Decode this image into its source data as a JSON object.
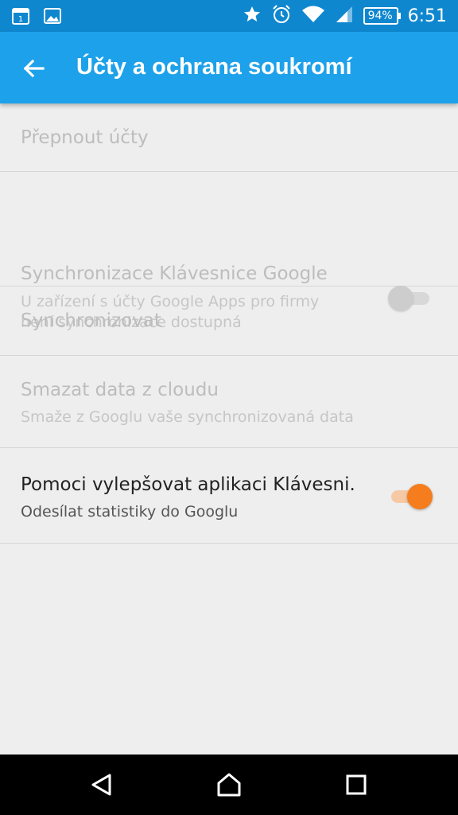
{
  "status_bar": {
    "battery": "94%",
    "time": "6:51",
    "icons": [
      "calendar-icon",
      "image-icon",
      "star-icon",
      "alarm-icon",
      "wifi-icon",
      "signal-icon",
      "battery-icon"
    ]
  },
  "app_bar": {
    "title": "Účty a ochrana soukromí",
    "back_icon": "arrow-back-icon"
  },
  "settings": {
    "items": [
      {
        "title": "Přepnout účty",
        "summary": "",
        "enabled": false
      },
      {
        "title": "Synchronizace Klávesnice Google",
        "summary_line1": "U zařízení s účty Google Apps pro firmy",
        "summary_line2": "není synchronizace dostupná",
        "enabled": false,
        "switch": "off"
      },
      {
        "title": "Synchronizovat",
        "summary": "",
        "enabled": false
      },
      {
        "title": "Smazat data z cloudu",
        "summary": "Smaže z Googlu vaše synchronizovaná data",
        "enabled": false
      },
      {
        "title": "Pomoci vylepšovat aplikaci Klávesni.",
        "summary": "Odesílat statistiky do Googlu",
        "enabled": true,
        "switch": "on"
      }
    ]
  },
  "colors": {
    "status_bar": "#0f87cf",
    "app_bar": "#1da1ea",
    "accent": "#f57d1e"
  },
  "nav_bar": {
    "icons": [
      "back-triangle-icon",
      "home-icon",
      "recents-icon"
    ]
  }
}
